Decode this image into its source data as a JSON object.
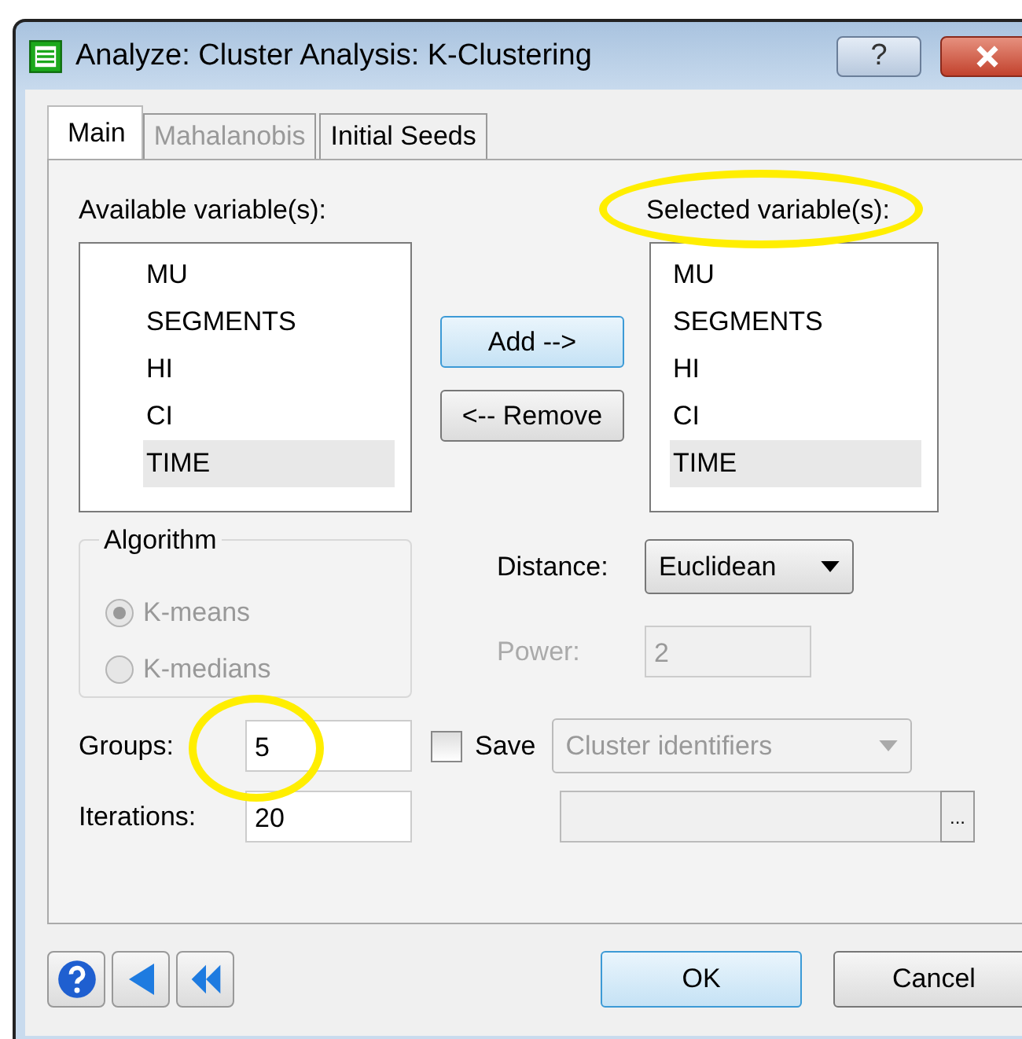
{
  "window": {
    "title": "Analyze: Cluster Analysis: K-Clustering",
    "help_glyph": "?"
  },
  "tabs": [
    {
      "label": "Main",
      "selected": true,
      "disabled": false
    },
    {
      "label": "Mahalanobis",
      "selected": false,
      "disabled": true
    },
    {
      "label": "Initial Seeds",
      "selected": false,
      "disabled": false
    }
  ],
  "available": {
    "label": "Available variable(s):",
    "items": [
      {
        "text": "MU",
        "selected": false
      },
      {
        "text": "SEGMENTS",
        "selected": false
      },
      {
        "text": "HI",
        "selected": false
      },
      {
        "text": "CI",
        "selected": false
      },
      {
        "text": "TIME",
        "selected": true
      }
    ]
  },
  "transfer_buttons": [
    "Add -->",
    "<-- Remove"
  ],
  "selected": {
    "label": "Selected variable(s):",
    "highlighted": true,
    "items": [
      {
        "text": "MU",
        "selected": false
      },
      {
        "text": "SEGMENTS",
        "selected": false
      },
      {
        "text": "HI",
        "selected": false
      },
      {
        "text": "CI",
        "selected": false
      },
      {
        "text": "TIME",
        "selected": true
      }
    ]
  },
  "algorithm": {
    "title": "Algorithm",
    "disabled": true,
    "options": [
      {
        "label": "K-means",
        "selected": true
      },
      {
        "label": "K-medians",
        "selected": false
      }
    ]
  },
  "distance": {
    "label": "Distance:",
    "value": "Euclidean"
  },
  "power": {
    "label": "Power:",
    "value": "2",
    "disabled": true
  },
  "groups": {
    "label": "Groups:",
    "value": "5",
    "highlighted": true
  },
  "iterations": {
    "label": "Iterations:",
    "value": "20"
  },
  "save": {
    "label": "Save",
    "checked": false,
    "option": "Cluster identifiers",
    "disabled": true,
    "browse": "..."
  },
  "buttons": [
    {
      "label": "OK",
      "default": true
    },
    {
      "label": "Cancel",
      "default": false
    }
  ]
}
